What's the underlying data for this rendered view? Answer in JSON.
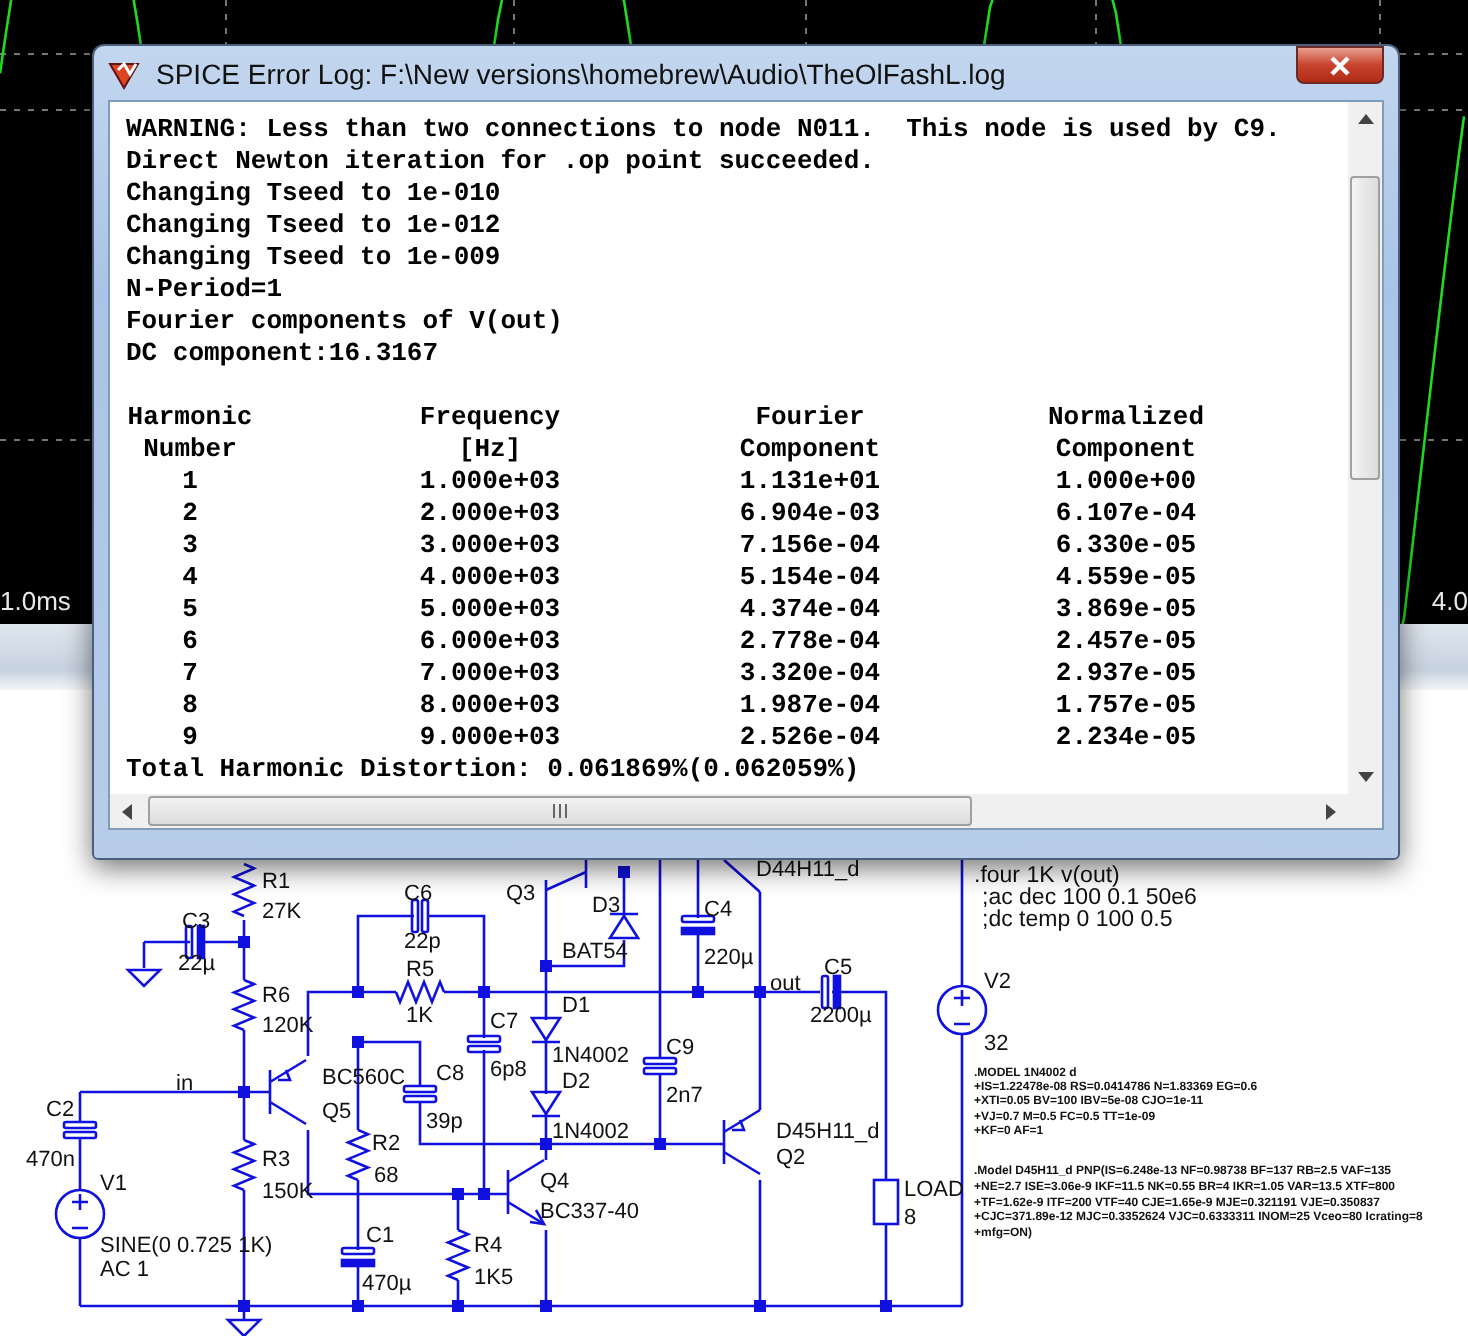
{
  "plot": {
    "axis_labels": [
      "1.0ms",
      "4.0"
    ]
  },
  "window": {
    "title": "SPICE Error Log: F:\\New versions\\homebrew\\Audio\\TheOlFashL.log"
  },
  "log": {
    "lines": [
      "WARNING: Less than two connections to node N011.  This node is used by C9.",
      "Direct Newton iteration for .op point succeeded.",
      "Changing Tseed to 1e-010",
      "Changing Tseed to 1e-012",
      "Changing Tseed to 1e-009",
      "N-Period=1",
      "Fourier components of V(out)",
      "DC component:16.3167"
    ],
    "table": {
      "columns": [
        {
          "title": "Harmonic",
          "subtitle": "Number"
        },
        {
          "title": "Frequency",
          "subtitle": "[Hz]"
        },
        {
          "title": "Fourier",
          "subtitle": "Component"
        },
        {
          "title": "Normalized",
          "subtitle": "Component"
        }
      ],
      "rows": [
        [
          "1",
          "1.000e+03",
          "1.131e+01",
          "1.000e+00"
        ],
        [
          "2",
          "2.000e+03",
          "6.904e-03",
          "6.107e-04"
        ],
        [
          "3",
          "3.000e+03",
          "7.156e-04",
          "6.330e-05"
        ],
        [
          "4",
          "4.000e+03",
          "5.154e-04",
          "4.559e-05"
        ],
        [
          "5",
          "5.000e+03",
          "4.374e-04",
          "3.869e-05"
        ],
        [
          "6",
          "6.000e+03",
          "2.778e-04",
          "2.457e-05"
        ],
        [
          "7",
          "7.000e+03",
          "3.320e-04",
          "2.937e-05"
        ],
        [
          "8",
          "8.000e+03",
          "1.987e-04",
          "1.757e-05"
        ],
        [
          "9",
          "9.000e+03",
          "2.526e-04",
          "2.234e-05"
        ]
      ]
    },
    "summary": "Total Harmonic Distortion: 0.061869%(0.062059%)"
  },
  "schematic": {
    "labels": [
      "R1",
      "27K",
      "C3",
      "22µ",
      "R6",
      "120K",
      "in",
      "C2",
      "470n",
      "V1",
      "SINE(0 0.725 1K)",
      "AC 1",
      "R3",
      "150K",
      "BC560C",
      "Q5",
      "C6",
      "22p",
      "R5",
      "1K",
      "C8",
      "39p",
      "C7",
      "6p8",
      "R2",
      "68",
      "C1",
      "470µ",
      "R4",
      "1K5",
      "Q4",
      "BC337-40",
      "Q3",
      "D3",
      "BAT54",
      "D1",
      "1N4002",
      "D2",
      "1N4002",
      "C4",
      "220µ",
      "C9",
      "2n7",
      "D44H11_d",
      "out",
      "C5",
      "2200µ",
      "D45H11_d",
      "Q2",
      "LOAD",
      "8",
      "V2",
      "32"
    ],
    "directives": [
      ".four 1K v(out)",
      ";ac dec 100 0.1 50e6",
      ";dc temp 0 100 0.5"
    ],
    "models": [
      ".MODEL 1N4002 d",
      "+IS=1.22478e-08 RS=0.0414786 N=1.83369 EG=0.6",
      "+XTI=0.05 BV=100 IBV=5e-08 CJO=1e-11",
      "+VJ=0.7 M=0.5 FC=0.5 TT=1e-09",
      "+KF=0 AF=1",
      ".Model D45H11_d PNP(IS=6.248e-13 NF=0.98738 BF=137 RB=2.5 VAF=135",
      "+NE=2.7 ISE=3.06e-9 IKF=11.5 NK=0.55 BR=4 IKR=1.05 VAR=13.5 XTF=800",
      "+TF=1.62e-9 ITF=200 VTF=40 CJE=1.65e-9 MJE=0.321191 VJE=0.350837",
      "+CJC=371.89e-12 MJC=0.3352624 VJC=0.6333311 INOM=25 Vceo=80 Icrating=8",
      "+mfg=ON)"
    ]
  }
}
